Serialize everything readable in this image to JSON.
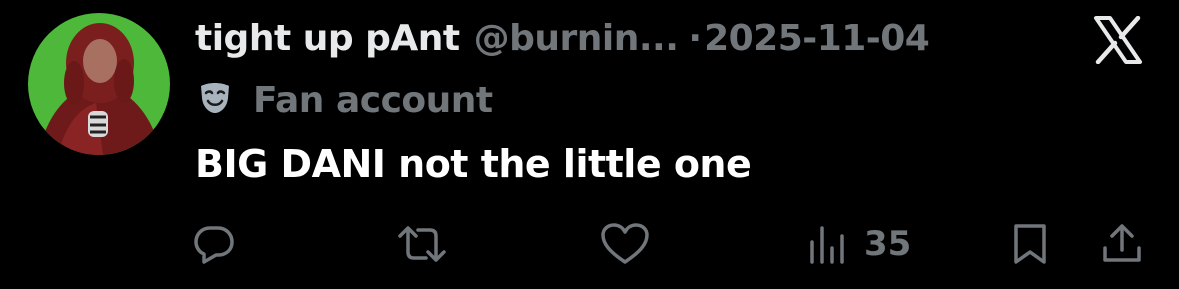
{
  "tweet": {
    "display_name": "tight up pAnt",
    "handle": "@burnin...",
    "separator": "·",
    "date": "2025-11-04",
    "label_icon": "theater-mask-icon",
    "label": "Fan account",
    "text": "BIG DANI not the little one"
  },
  "actions": {
    "reply_icon": "reply-icon",
    "retweet_icon": "retweet-icon",
    "like_icon": "heart-icon",
    "views_icon": "views-icon",
    "views_count": "35",
    "bookmark_icon": "bookmark-icon",
    "share_icon": "share-icon"
  },
  "colors": {
    "background": "#000000",
    "primary_text": "#e7e9ea",
    "secondary_text": "#71767b",
    "avatar_bg": "#4db83a",
    "coat": "#6e1a1a"
  }
}
